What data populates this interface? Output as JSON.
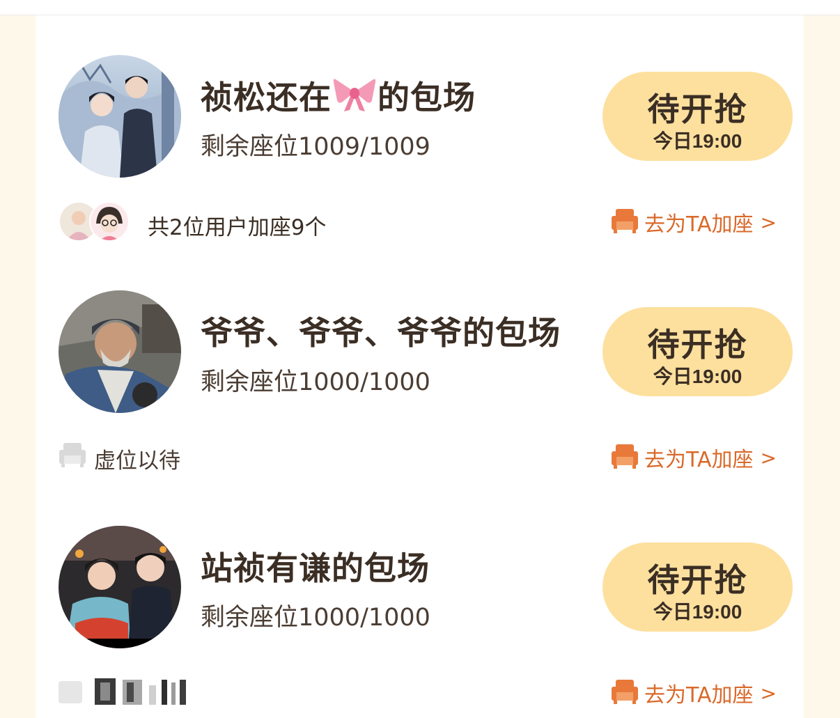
{
  "cards": [
    {
      "title_pre": "祯松还在",
      "title_emoji": "🎀",
      "title_post": "的包场",
      "seats": "剩余座位1009/1009",
      "button_label": "待开抢",
      "button_time": "今日19:00",
      "footer_text": "共2位用户加座9个",
      "add_seat_label": "去为TA加座",
      "add_seat_chevron": ">"
    },
    {
      "title": "爷爷、爷爷、爷爷的包场",
      "seats": "剩余座位1000/1000",
      "button_label": "待开抢",
      "button_time": "今日19:00",
      "footer_text": "虚位以待",
      "add_seat_label": "去为TA加座",
      "add_seat_chevron": ">"
    },
    {
      "title": "站祯有谦的包场",
      "seats": "剩余座位1000/1000",
      "button_label": "待开抢",
      "button_time": "今日19:00",
      "add_seat_label": "去为TA加座",
      "add_seat_chevron": ">"
    }
  ],
  "colors": {
    "page_bg": "#fdf8e9",
    "button_bg": "#fde09e",
    "title_text": "#3b2e24",
    "accent_orange": "#d9692a"
  },
  "icons": {
    "sofa": "sofa-icon",
    "empty_seat": "empty-seat-icon",
    "bow": "bow-emoji"
  }
}
